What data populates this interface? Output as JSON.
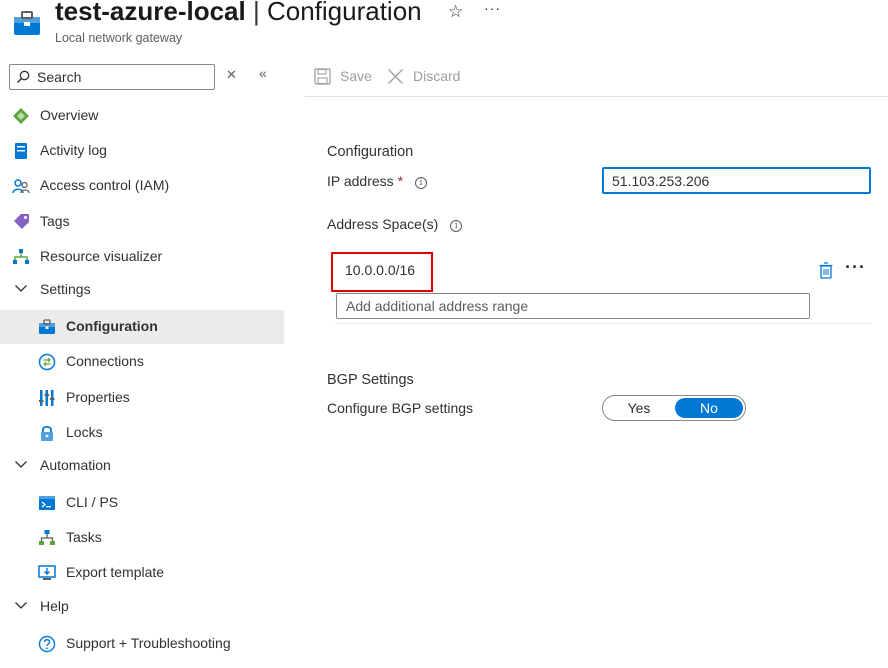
{
  "header": {
    "resource_name": "test-azure-local",
    "separator": "|",
    "page_title": "Configuration",
    "subtitle": "Local network gateway",
    "favorite_icon": "star-icon",
    "more_icon": "ellipsis-icon"
  },
  "sidebar": {
    "search_placeholder": "Search",
    "items": [
      {
        "label": "Overview",
        "icon": "overview-icon"
      },
      {
        "label": "Activity log",
        "icon": "activity-log-icon"
      },
      {
        "label": "Access control (IAM)",
        "icon": "iam-icon"
      },
      {
        "label": "Tags",
        "icon": "tag-icon"
      },
      {
        "label": "Resource visualizer",
        "icon": "visualizer-icon"
      },
      {
        "label": "Settings",
        "icon": "chevron-down-icon"
      },
      {
        "label": "Configuration",
        "icon": "configuration-icon",
        "selected": true
      },
      {
        "label": "Connections",
        "icon": "connections-icon"
      },
      {
        "label": "Properties",
        "icon": "properties-icon"
      },
      {
        "label": "Locks",
        "icon": "lock-icon"
      },
      {
        "label": "Automation",
        "icon": "chevron-down-icon"
      },
      {
        "label": "CLI / PS",
        "icon": "cli-icon"
      },
      {
        "label": "Tasks",
        "icon": "tasks-icon"
      },
      {
        "label": "Export template",
        "icon": "export-template-icon"
      },
      {
        "label": "Help",
        "icon": "chevron-down-icon"
      },
      {
        "label": "Support + Troubleshooting",
        "icon": "support-icon"
      }
    ]
  },
  "toolbar": {
    "save_label": "Save",
    "discard_label": "Discard"
  },
  "main": {
    "configuration_title": "Configuration",
    "ip_label": "IP address",
    "required_mark": "*",
    "ip_value": "51.103.253.206",
    "address_space_label": "Address Space(s)",
    "address_value": "10.0.0.0/16",
    "add_range_placeholder": "Add additional address range",
    "bgp_title": "BGP Settings",
    "bgp_label": "Configure BGP settings",
    "toggle_yes": "Yes",
    "toggle_no": "No",
    "toggle_selected": "No"
  },
  "colors": {
    "accent": "#0078d4",
    "highlight_box": "#e00000",
    "selected_bg": "#edebe9",
    "required": "#a4262c"
  }
}
